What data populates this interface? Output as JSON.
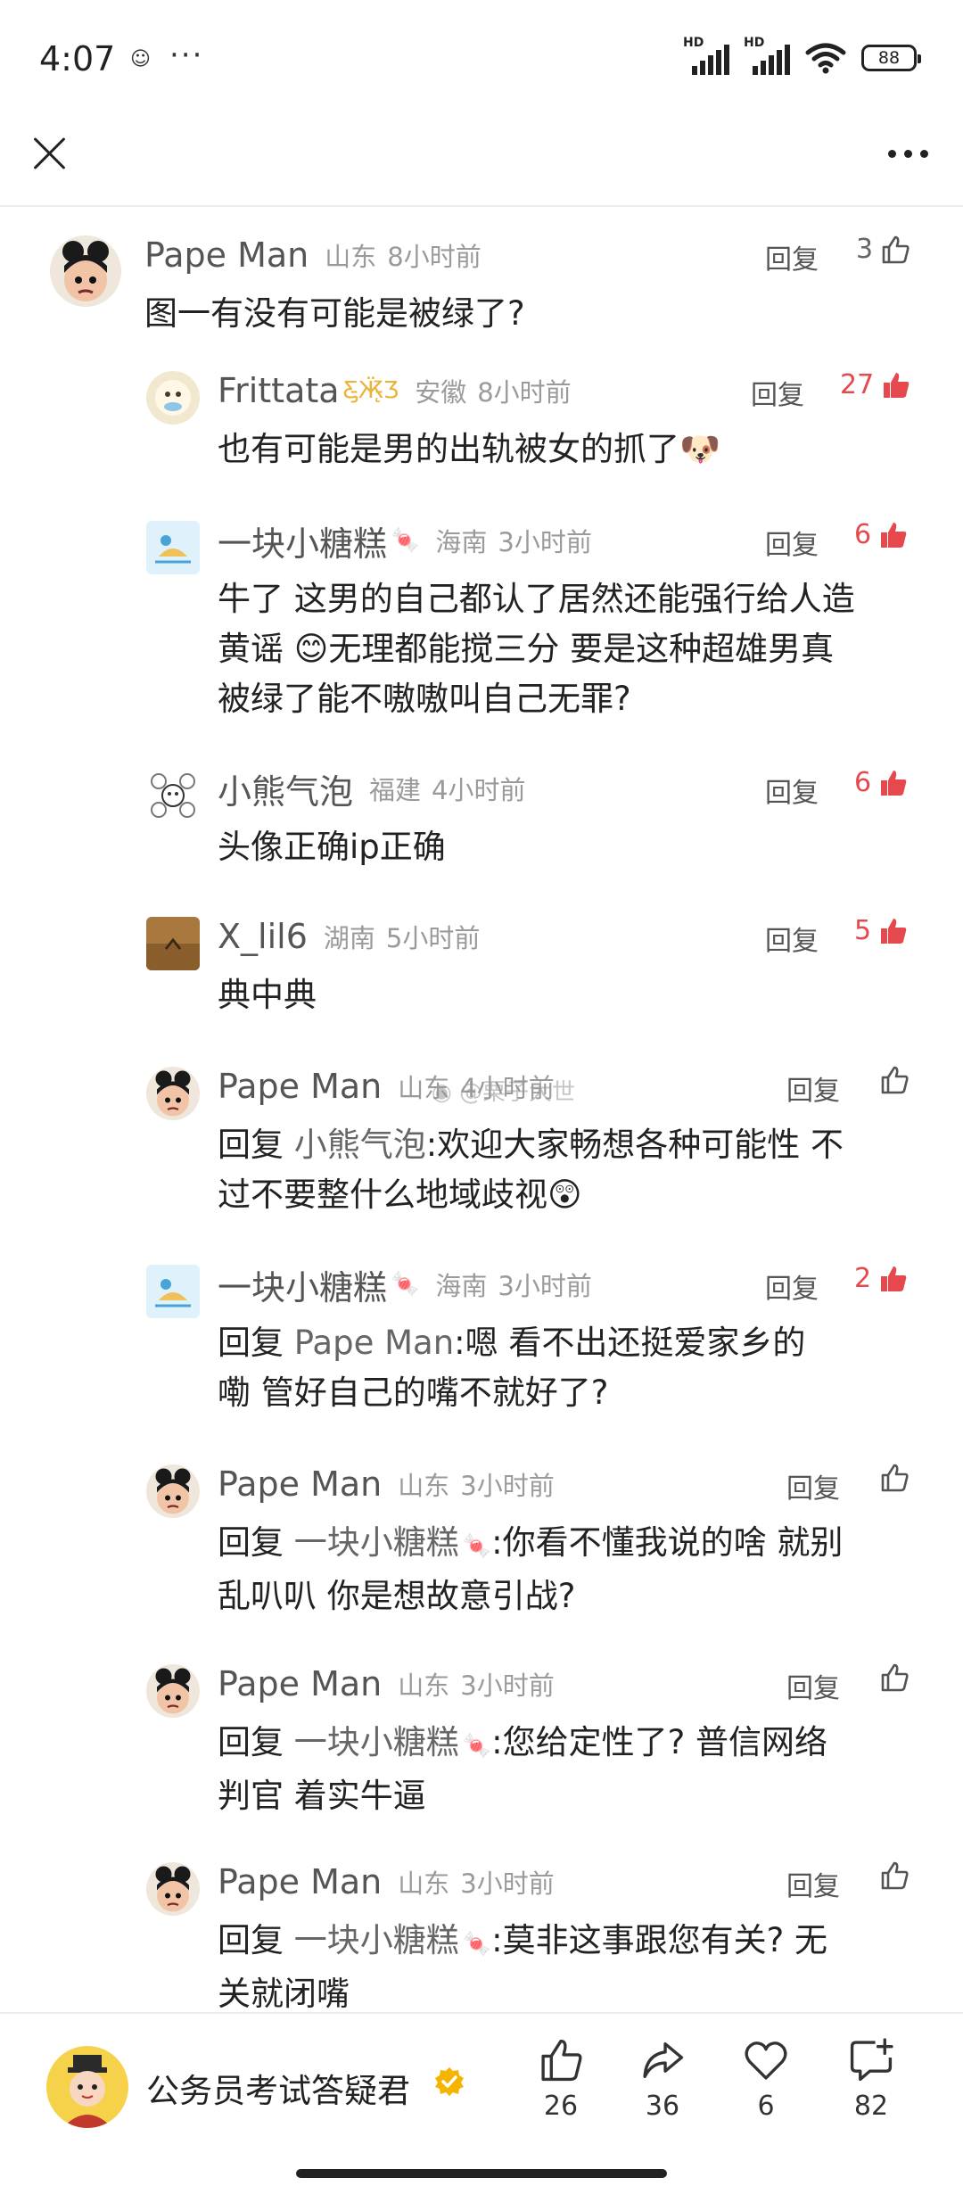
{
  "status": {
    "time": "4:07",
    "battery": "88",
    "network_label": "HD"
  },
  "comments": [
    {
      "user": "Pape Man",
      "location": "山东",
      "time": "8小时前",
      "reply_label": "回复",
      "likes": "3",
      "text": "图一有没有可能是被绿了?"
    },
    {
      "user": "Frittata",
      "location": "安徽",
      "time": "8小时前",
      "reply_label": "回复",
      "likes": "27",
      "text": "也有可能是男的出轨被女的抓了"
    },
    {
      "user": "一块小糖糕",
      "location": "海南",
      "time": "3小时前",
      "reply_label": "回复",
      "likes": "6",
      "text_1": "牛了 这男的自己都认了居然还能强行给人造",
      "text_2a": "黄谣 ",
      "text_2b": "无理都能搅三分 要是这种超雄男真",
      "text_3": "被绿了能不嗷嗷叫自己无罪?"
    },
    {
      "user": "小熊气泡",
      "location": "福建",
      "time": "4小时前",
      "reply_label": "回复",
      "likes": "6",
      "text": "头像正确ip正确"
    },
    {
      "user": "X_lil6",
      "location": "湖南",
      "time": "5小时前",
      "reply_label": "回复",
      "likes": "5",
      "text": "典中典"
    },
    {
      "user": "Pape Man",
      "location": "山东",
      "time": "4小时前",
      "reply_label": "回复",
      "watermark": "@栗子大世",
      "prefix": "回复 ",
      "target": "小熊气泡",
      "text_1": ":欢迎大家畅想各种可能性 不",
      "text_2": "过不要整什么地域歧视"
    },
    {
      "user": "一块小糖糕",
      "location": "海南",
      "time": "3小时前",
      "reply_label": "回复",
      "likes": "2",
      "prefix": "回复 ",
      "target": "Pape Man",
      "text_1": ":嗯 看不出还挺爱家乡的",
      "text_2": "嘞 管好自己的嘴不就好了?"
    },
    {
      "user": "Pape Man",
      "location": "山东",
      "time": "3小时前",
      "reply_label": "回复",
      "prefix": "回复 ",
      "target": "一块小糖糕",
      "text_1": ":你看不懂我说的啥 就别",
      "text_2": "乱叭叭 你是想故意引战?"
    },
    {
      "user": "Pape Man",
      "location": "山东",
      "time": "3小时前",
      "reply_label": "回复",
      "prefix": "回复 ",
      "target": "一块小糖糕",
      "text_1": ":您给定性了? 普信网络",
      "text_2": "判官 着实牛逼"
    },
    {
      "user": "Pape Man",
      "location": "山东",
      "time": "3小时前",
      "reply_label": "回复",
      "prefix": "回复 ",
      "target": "一块小糖糕",
      "text_1": ":莫非这事跟您有关? 无",
      "text_2": "关就闭嘴"
    }
  ],
  "bottom": {
    "author": "公务员考试答疑君",
    "like_count": "26",
    "share_count": "36",
    "fav_count": "6",
    "comment_count": "82"
  },
  "colors": {
    "accent_red": "#e5484d",
    "meta_gray": "#9a9a9a"
  }
}
